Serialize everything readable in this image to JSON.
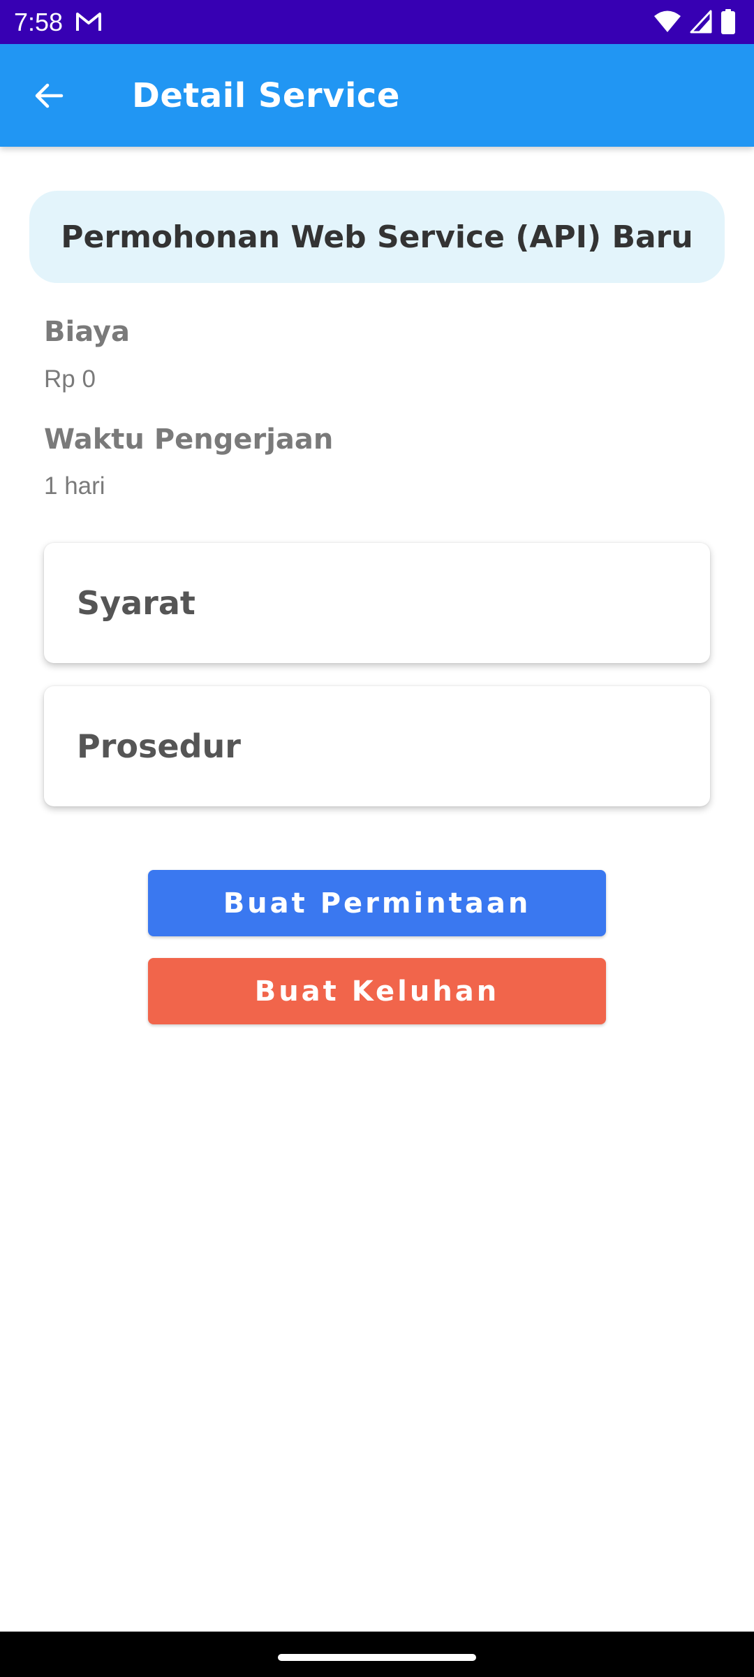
{
  "status_bar": {
    "time": "7:58",
    "background": "#3700b3",
    "icons": [
      "gmail-icon",
      "wifi-icon",
      "signal-icon",
      "battery-icon"
    ]
  },
  "app_bar": {
    "title": "Detail Service",
    "background": "#2196f3",
    "back_icon": "arrow-back-icon"
  },
  "service": {
    "name": "Permohonan Web Service (API) Baru",
    "header_background": "#e3f4fb"
  },
  "fields": {
    "biaya_label": "Biaya",
    "biaya_value": "Rp 0",
    "waktu_label": "Waktu Pengerjaan",
    "waktu_value": "1 hari"
  },
  "cards": {
    "syarat": "Syarat",
    "prosedur": "Prosedur"
  },
  "buttons": {
    "request_label": "Buat Permintaan",
    "request_color": "#3a78f0",
    "complaint_label": "Buat Keluhan",
    "complaint_color": "#f1654b"
  }
}
